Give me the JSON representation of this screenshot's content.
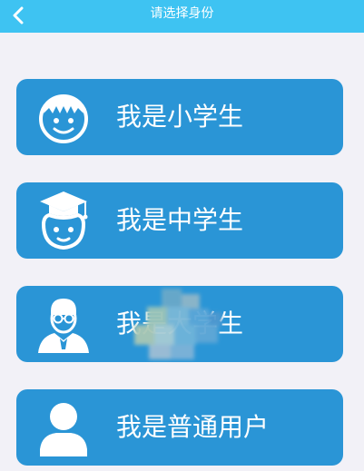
{
  "header": {
    "title": "请选择身份",
    "back_icon": "chevron-left-icon"
  },
  "options": [
    {
      "label": "我是小学生",
      "icon": "boy-face-icon"
    },
    {
      "label": "我是中学生",
      "icon": "graduate-cap-icon"
    },
    {
      "label": "我是大学生",
      "icon": "student-glasses-icon"
    },
    {
      "label": "我是普通用户",
      "icon": "user-icon"
    }
  ],
  "colors": {
    "header_bg": "#3ec3f2",
    "card_bg": "#2a95d6",
    "page_bg": "#f2f1f7"
  }
}
